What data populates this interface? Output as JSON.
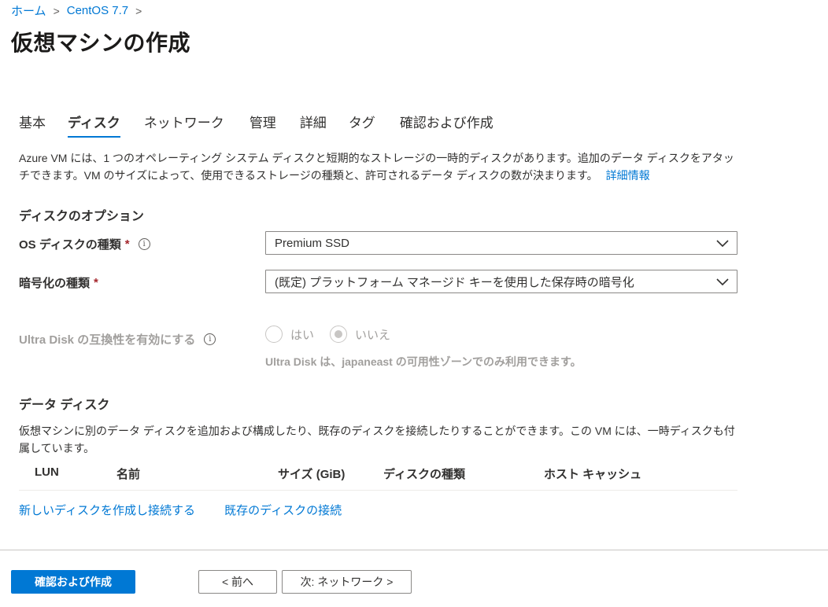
{
  "breadcrumb": {
    "home": "ホーム",
    "sep1": ">",
    "item": "CentOS 7.7",
    "sep2": ">"
  },
  "page_title": "仮想マシンの作成",
  "tabs": [
    {
      "label": "基本",
      "active": false
    },
    {
      "label": "ディスク",
      "active": true
    },
    {
      "label": "ネットワーク",
      "active": false
    },
    {
      "label": "管理",
      "active": false
    },
    {
      "label": "詳細",
      "active": false
    },
    {
      "label": "タグ",
      "active": false
    },
    {
      "label": "確認および作成",
      "active": false
    }
  ],
  "intro": {
    "text": "Azure VM には、1 つのオペレーティング システム ディスクと短期的なストレージの一時的ディスクがあります。追加のデータ ディスクをアタッチできます。VM のサイズによって、使用できるストレージの種類と、許可されるデータ ディスクの数が決まります。",
    "link": "詳細情報"
  },
  "disk_options": {
    "heading": "ディスクのオプション",
    "os_disk_type": {
      "label": "OS ディスクの種類",
      "required_mark": "*",
      "info": "i",
      "value": "Premium SSD"
    },
    "encryption_type": {
      "label": "暗号化の種類",
      "required_mark": "*",
      "value": "(既定) プラットフォーム マネージド キーを使用した保存時の暗号化"
    },
    "ultra_disk": {
      "label": "Ultra Disk の互換性を有効にする",
      "info": "i",
      "options": [
        "はい",
        "いいえ"
      ],
      "selected": "いいえ",
      "note": "Ultra Disk は、japaneast の可用性ゾーンでのみ利用できます。"
    }
  },
  "data_disks": {
    "heading": "データ ディスク",
    "description": "仮想マシンに別のデータ ディスクを追加および構成したり、既存のディスクを接続したりすることができます。この VM には、一時ディスクも付属しています。",
    "columns": [
      "LUN",
      "名前",
      "サイズ (GiB)",
      "ディスクの種類",
      "ホスト キャッシュ"
    ],
    "create_link": "新しいディスクを作成し接続する",
    "attach_link": "既存のディスクの接続"
  },
  "footer": {
    "review_create": "確認および作成",
    "previous": "< 前へ",
    "next": "次: ネットワーク >"
  },
  "colors": {
    "accent": "#0078d4",
    "required": "#a4262c",
    "disabled": "#a19f9d"
  }
}
